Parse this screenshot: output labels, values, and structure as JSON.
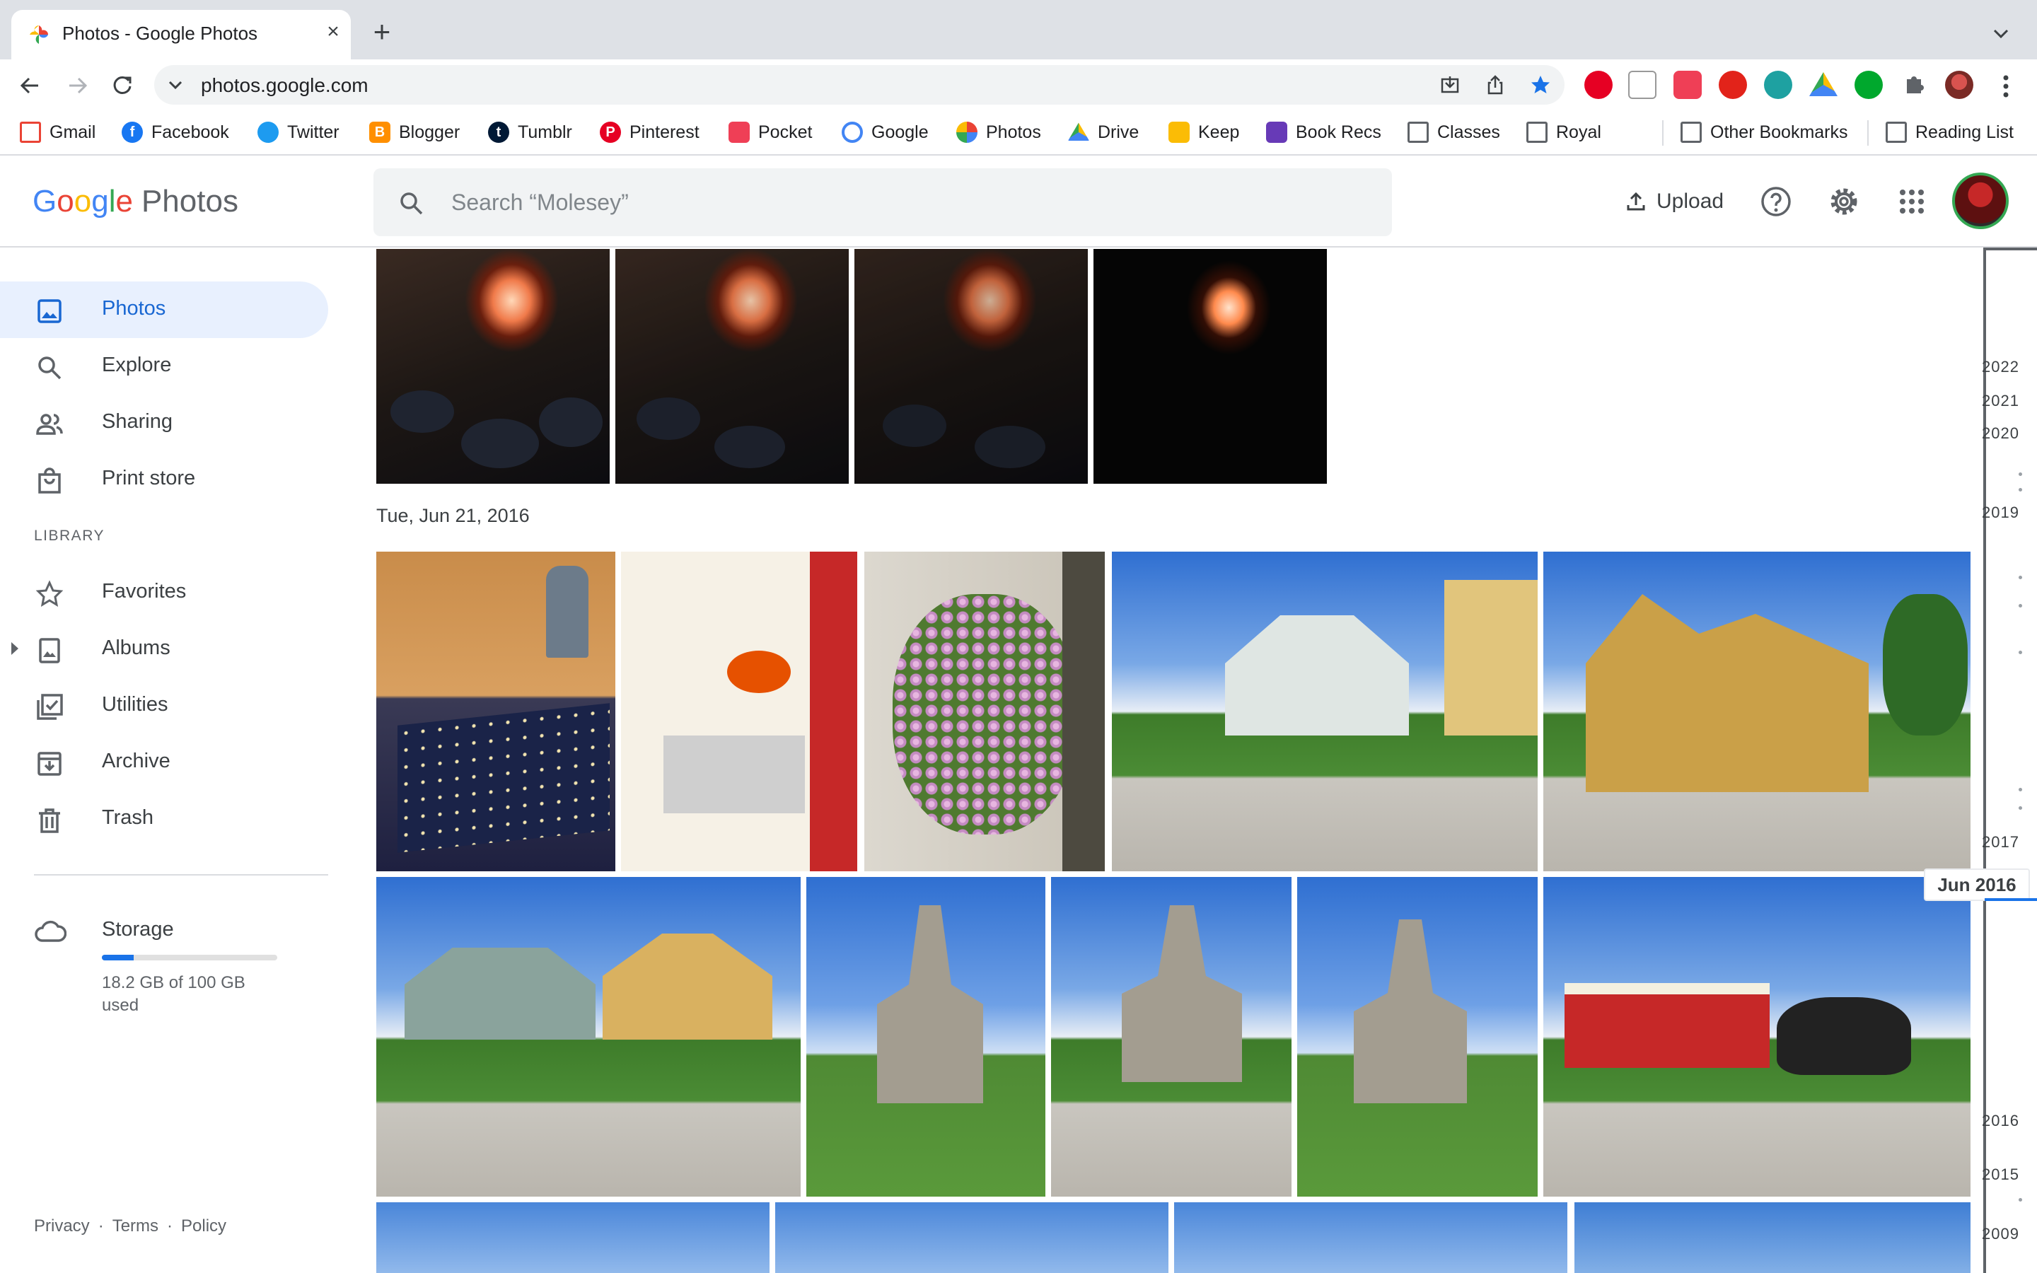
{
  "browser": {
    "tab_title": "Photos - Google Photos",
    "url": "photos.google.com",
    "bookmarks": [
      "Gmail",
      "Facebook",
      "Twitter",
      "Blogger",
      "Tumblr",
      "Pinterest",
      "Pocket",
      "Google",
      "Photos",
      "Drive",
      "Keep",
      "Book Recs",
      "Classes",
      "Royal"
    ],
    "other_bookmarks": "Other Bookmarks",
    "reading_list": "Reading List"
  },
  "header": {
    "logo": {
      "g": "G",
      "o1": "o",
      "o2": "o",
      "g2": "g",
      "l": "l",
      "e": "e",
      "product": "Photos"
    },
    "search_placeholder": "Search “Molesey”",
    "upload_label": "Upload"
  },
  "sidebar": {
    "items": [
      {
        "label": "Photos",
        "icon": "photo-icon",
        "active": true
      },
      {
        "label": "Explore",
        "icon": "search-icon"
      },
      {
        "label": "Sharing",
        "icon": "people-icon"
      },
      {
        "label": "Print store",
        "icon": "shopping-bag-icon"
      }
    ],
    "library_label": "LIBRARY",
    "library_items": [
      {
        "label": "Favorites",
        "icon": "star-icon"
      },
      {
        "label": "Albums",
        "icon": "album-icon"
      },
      {
        "label": "Utilities",
        "icon": "checklist-icon"
      },
      {
        "label": "Archive",
        "icon": "archive-icon"
      },
      {
        "label": "Trash",
        "icon": "trash-icon"
      }
    ],
    "storage": {
      "label": "Storage",
      "used_fraction": 0.182,
      "text": "18.2 GB of 100 GB used"
    },
    "footer": {
      "privacy": "Privacy",
      "terms": "Terms",
      "policy": "Policy"
    }
  },
  "main": {
    "date_heading": "Tue, Jun 21, 2016"
  },
  "timeline": {
    "years": [
      "2022",
      "2021",
      "2020",
      "2019",
      "2017",
      "2016",
      "2015",
      "2009"
    ],
    "current": "Jun 2016"
  },
  "colors": {
    "accent": "#1a73e8",
    "active_bg": "#e8f0fe"
  }
}
